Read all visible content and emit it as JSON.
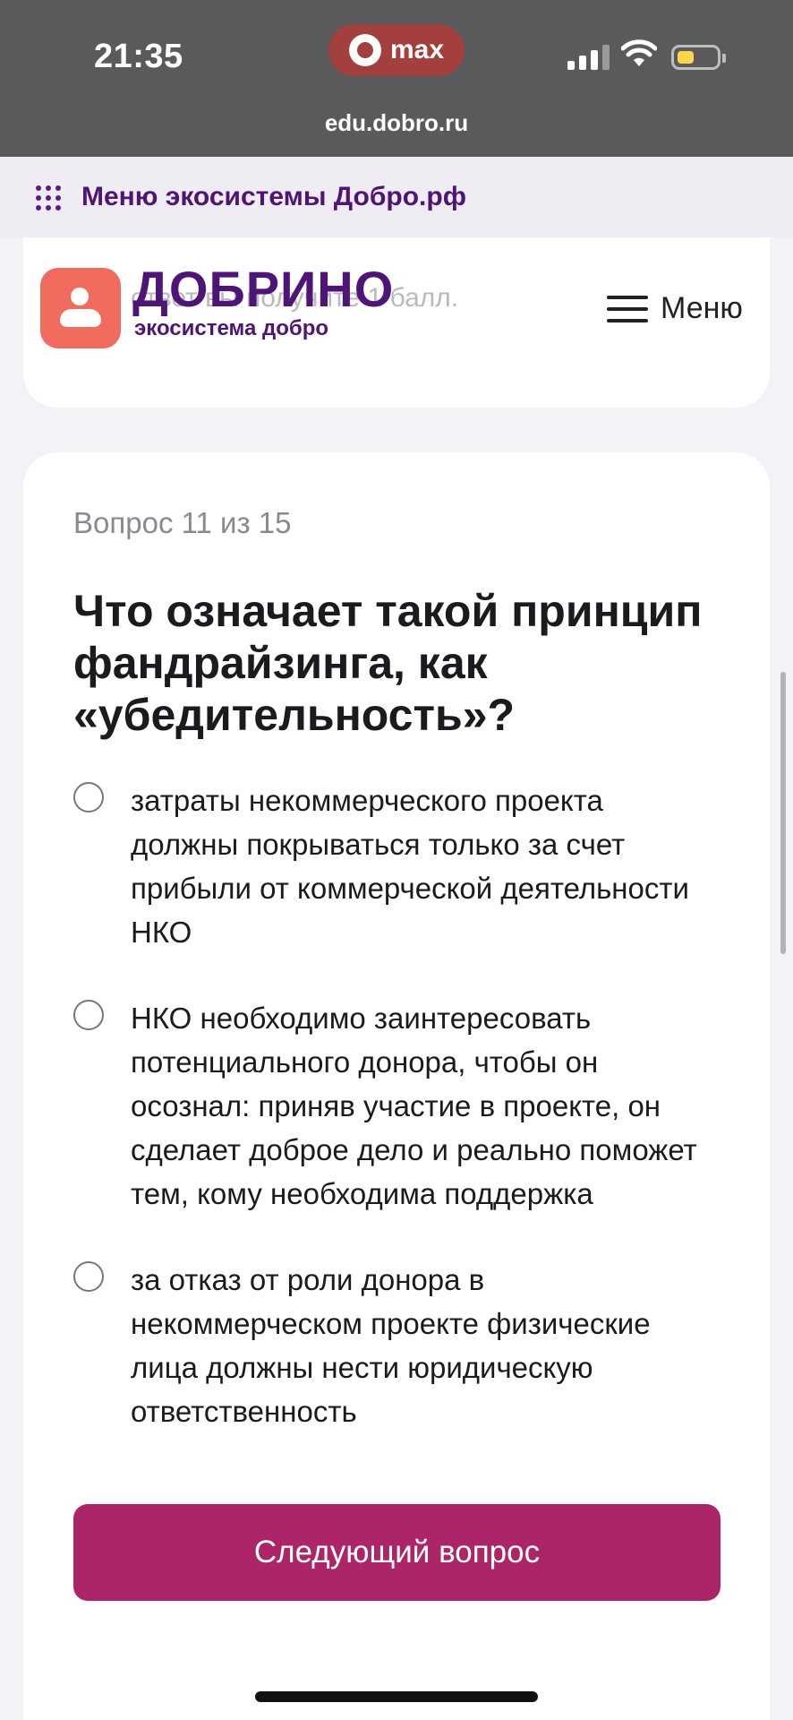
{
  "status_bar": {
    "time": "21:35",
    "app_pill_label": "max",
    "url": "edu.dobro.ru",
    "battery_color": "#ffd84a"
  },
  "eco_bar": {
    "label": "Меню экосистемы Добро.рф",
    "icon": "grid-dots-icon"
  },
  "header": {
    "brand_name": "ДОБРИНО",
    "brand_sub_prefix": "экосистема ",
    "brand_sub_bold": "добро",
    "menu_label": "Меню",
    "brand_color": "#4e1577",
    "logo_color": "#f26b5f"
  },
  "top_card": {
    "partial_text": "ответ вы получите 1 балл."
  },
  "question": {
    "counter": "Вопрос 11 из 15",
    "title": "Что означает такой принцип фандрайзинга, как «убедительность»?",
    "options": [
      {
        "label": "затраты некоммерческого проекта должны покрываться только за счет прибыли от коммерческой деятельности НКО"
      },
      {
        "label": "НКО необходимо заинтересовать потенциального донора, чтобы он осознал: приняв участие в проекте, он сделает доброе дело и реально поможет тем, кому необходима поддержка"
      },
      {
        "label": "за отказ от роли донора в некоммерческом проекте физические лица должны нести юридическую ответственность"
      }
    ],
    "next_button_label": "Следующий вопрос",
    "accent_color": "#ac2568"
  }
}
